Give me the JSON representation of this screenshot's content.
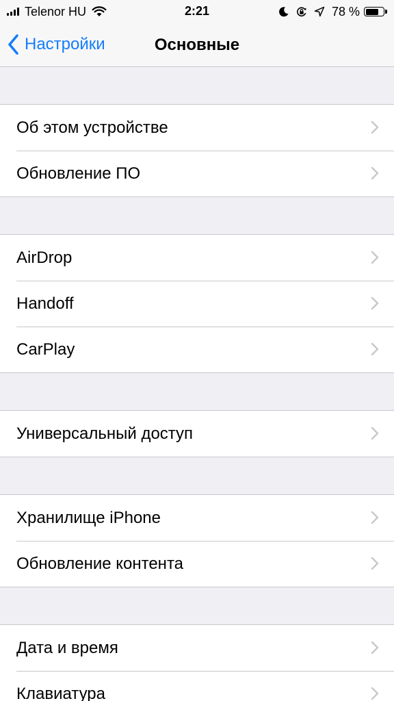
{
  "status_bar": {
    "carrier": "Telenor HU",
    "time": "2:21",
    "battery_percent": "78 %",
    "battery_level": 0.78,
    "icons": [
      "signal-icon",
      "wifi-icon",
      "moon-icon",
      "orientation-lock-icon",
      "location-arrow-icon",
      "battery-icon"
    ]
  },
  "nav": {
    "back_label": "Настройки",
    "title": "Основные"
  },
  "groups": [
    {
      "items": [
        "Об этом устройстве",
        "Обновление ПО"
      ]
    },
    {
      "items": [
        "AirDrop",
        "Handoff",
        "CarPlay"
      ]
    },
    {
      "items": [
        "Универсальный доступ"
      ]
    },
    {
      "items": [
        "Хранилище iPhone",
        "Обновление контента"
      ]
    },
    {
      "items": [
        "Дата и время",
        "Клавиатура"
      ]
    }
  ],
  "colors": {
    "accent": "#147efb",
    "background": "#efeff4",
    "separator": "#c8c7cc",
    "chevron": "#c7c7cc"
  }
}
